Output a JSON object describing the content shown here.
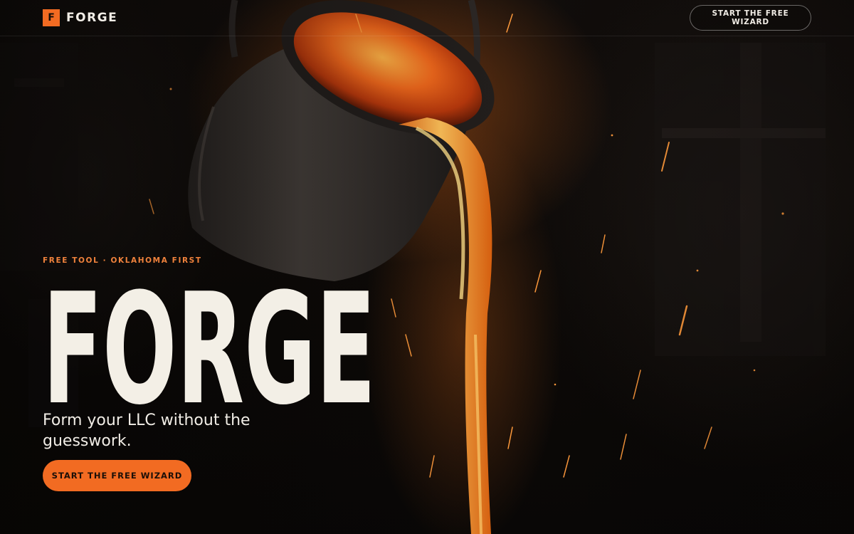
{
  "nav": {
    "logo_mark": "F",
    "brand_name": "FORGE",
    "cta_label": "START THE FREE WIZARD"
  },
  "hero": {
    "eyebrow": "FREE TOOL · OKLAHOMA FIRST",
    "title": "FORGE",
    "subtitle": "Form your LLC without the guesswork.",
    "cta_label": "START THE FREE WIZARD"
  },
  "colors": {
    "accent": "#f26b22",
    "eyebrow": "#f0823c",
    "text_light": "#f1ede6",
    "background": "#0c0907"
  }
}
